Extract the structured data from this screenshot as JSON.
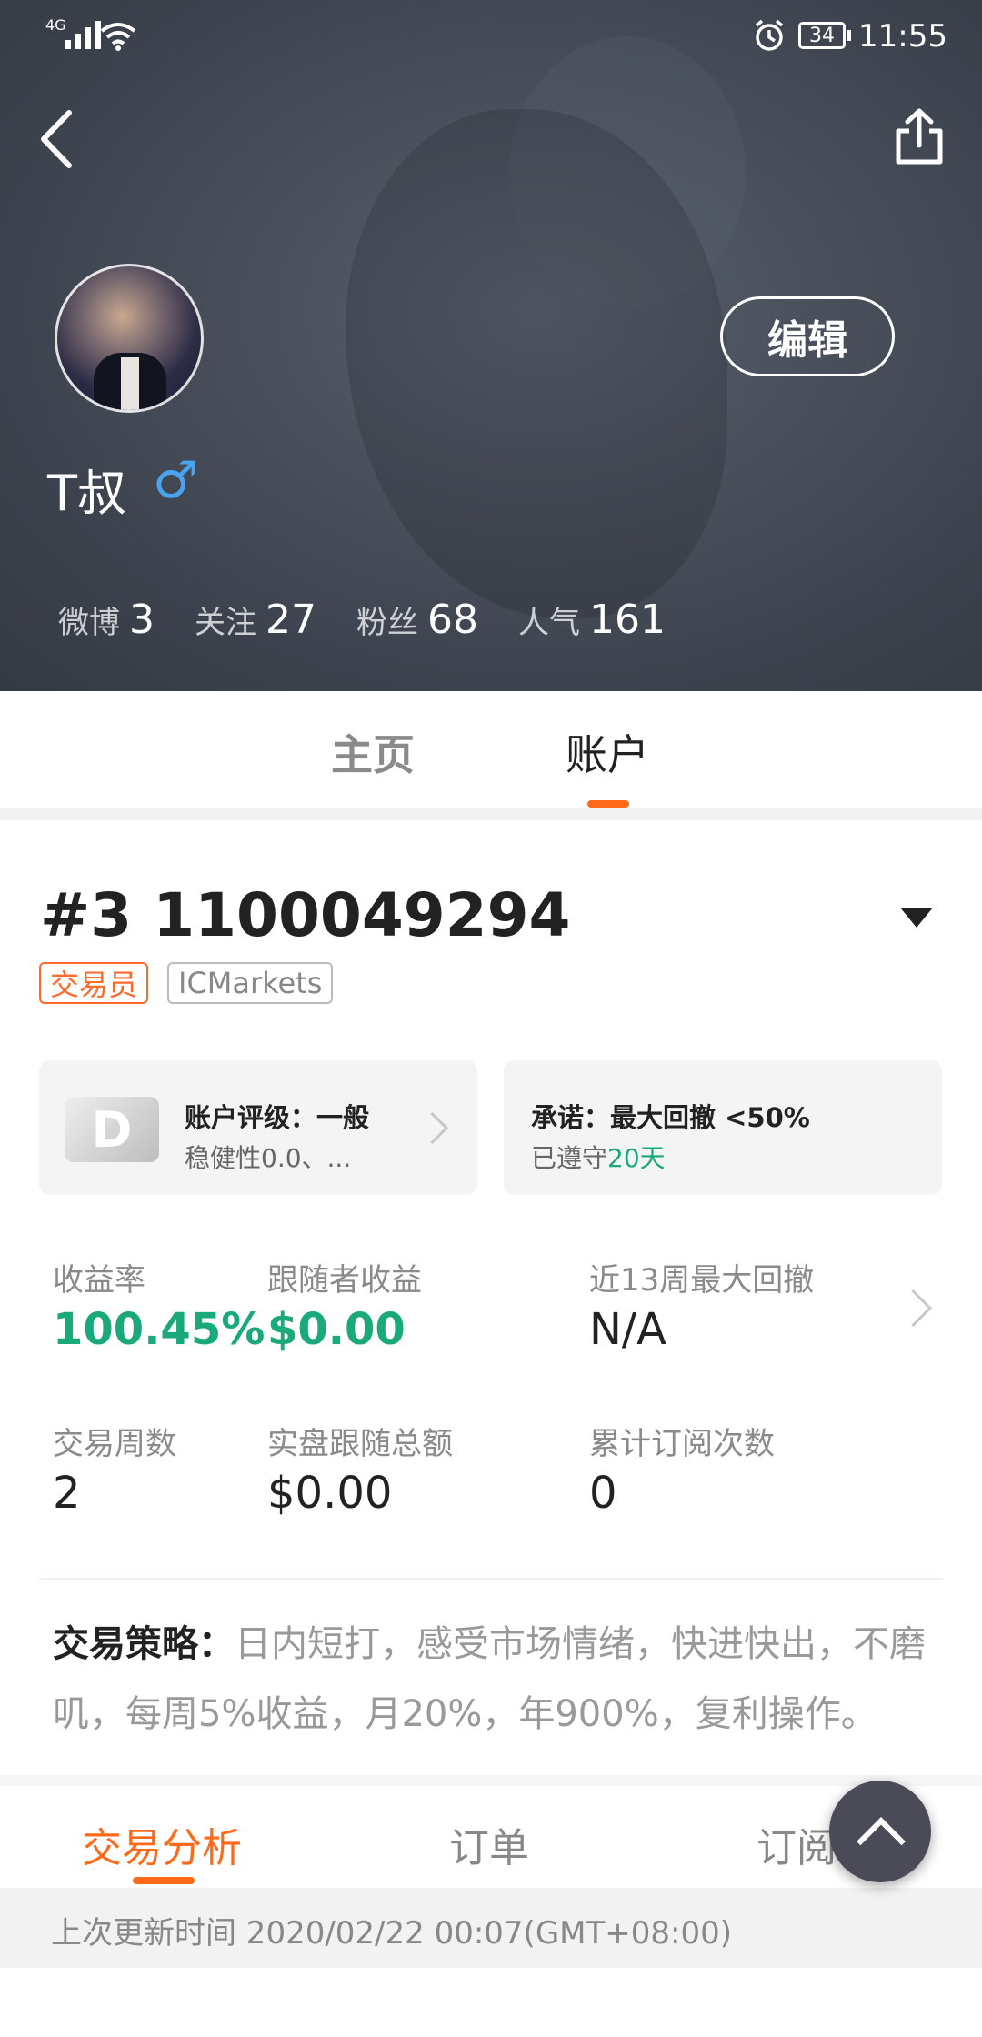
{
  "status_bar": {
    "network": "4G",
    "battery": "34",
    "time": "11:55"
  },
  "profile": {
    "edit_label": "编辑",
    "username": "T叔",
    "gender_symbol": "♂",
    "stats": [
      {
        "label": "微博",
        "value": "3"
      },
      {
        "label": "关注",
        "value": "27"
      },
      {
        "label": "粉丝",
        "value": "68"
      },
      {
        "label": "人气",
        "value": "161"
      }
    ]
  },
  "tabs": [
    {
      "label": "主页"
    },
    {
      "label": "账户"
    }
  ],
  "account": {
    "title": "#3 1100049294",
    "tags": [
      "交易员",
      "ICMarkets"
    ],
    "rating_card": {
      "grade": "D",
      "title": "账户评级：一般",
      "subtitle": "稳健性0.0、..."
    },
    "promise_card": {
      "title": "承诺：最大回撤 <50%",
      "sub_prefix": "已遵守",
      "sub_value": "20天"
    },
    "metrics": [
      {
        "label": "收益率",
        "value": "100.45%"
      },
      {
        "label": "跟随者收益",
        "value": "$0.00"
      },
      {
        "label": "近13周最大回撤",
        "value": "N/A"
      },
      {
        "label": "交易周数",
        "value": "2"
      },
      {
        "label": "实盘跟随总额",
        "value": "$0.00"
      },
      {
        "label": "累计订阅次数",
        "value": "0"
      }
    ],
    "strategy_label": "交易策略：",
    "strategy_text": "日内短打，感受市场情绪，快进快出，不磨叽，每周5%收益，月20%，年900%，复利操作。"
  },
  "bottom_tabs": [
    {
      "label": "交易分析"
    },
    {
      "label": "订单"
    },
    {
      "label": "订阅者"
    }
  ],
  "update_text": "上次更新时间 2020/02/22 00:07(GMT+08:00)",
  "colors": {
    "accent": "#ff6a1a",
    "positive": "#1aa97a",
    "header_bg": "#434955"
  }
}
